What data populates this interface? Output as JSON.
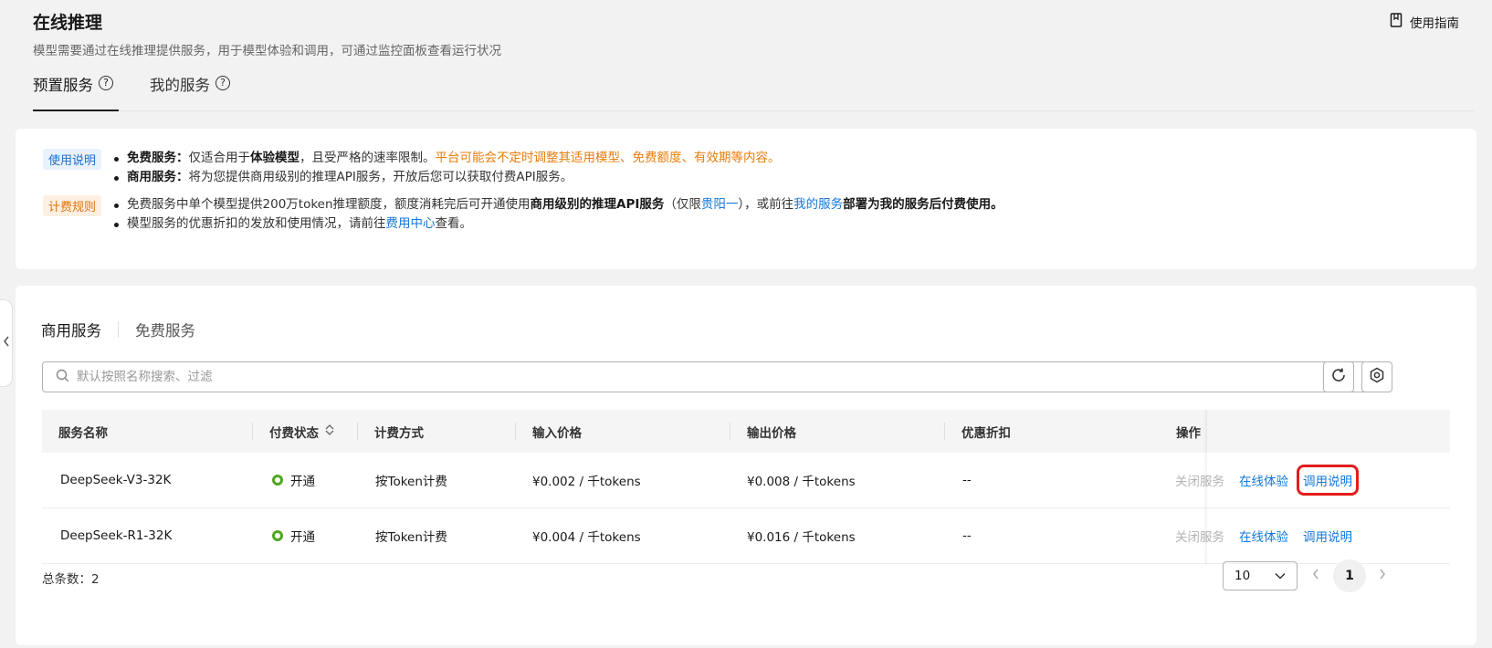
{
  "header": {
    "title": "在线推理",
    "subtitle": "模型需要通过在线推理提供服务，用于模型体验和调用，可通过监控面板查看运行状况",
    "guide_label": "使用指南"
  },
  "tabs": [
    {
      "label": "预置服务"
    },
    {
      "label": "我的服务"
    }
  ],
  "notice": {
    "usage_tag": "使用说明",
    "usage_line1_bold": "免费服务：",
    "usage_line1_text1": "仅适合用于",
    "usage_line1_bold2": "体验模型",
    "usage_line1_text2": "，且受严格的速率限制。",
    "usage_line1_orange": "平台可能会不定时调整其适用模型、免费额度、有效期等内容。",
    "usage_line2_bold": "商用服务：",
    "usage_line2_text": "将为您提供商用级别的推理API服务，开放后您可以获取付费API服务。",
    "billing_tag": "计费规则",
    "billing_line1_text1": "免费服务中单个模型提供200万token推理额度，额度消耗完后可开通使用",
    "billing_line1_bold1": "商用级别的推理API服务",
    "billing_line1_text2": "（仅限",
    "billing_line1_link1": "贵阳一",
    "billing_line1_text3": "），或前往",
    "billing_line1_link2": "我的服务",
    "billing_line1_bold2": "部署为我的服务后付费使用。",
    "billing_line2_text1": "模型服务的优惠折扣的发放和使用情况，请前往",
    "billing_line2_link": "费用中心",
    "billing_line2_text2": "查看。"
  },
  "subtabs": {
    "active": "商用服务",
    "inactive": "免费服务"
  },
  "search": {
    "placeholder": "默认按照名称搜索、过滤"
  },
  "table": {
    "columns": [
      "服务名称",
      "付费状态",
      "计费方式",
      "输入价格",
      "输出价格",
      "优惠折扣",
      "操作"
    ],
    "rows": [
      {
        "name": "DeepSeek-V3-32K",
        "status": "开通",
        "billing": "按Token计费",
        "input_price": "¥0.002 / 千tokens",
        "output_price": "¥0.008 / 千tokens",
        "discount": "--",
        "op_close": "关闭服务",
        "op_try": "在线体验",
        "op_doc": "调用说明"
      },
      {
        "name": "DeepSeek-R1-32K",
        "status": "开通",
        "billing": "按Token计费",
        "input_price": "¥0.004 / 千tokens",
        "output_price": "¥0.016 / 千tokens",
        "discount": "--",
        "op_close": "关闭服务",
        "op_try": "在线体验",
        "op_doc": "调用说明"
      }
    ]
  },
  "pagination": {
    "total_label": "总条数：2",
    "page_size": "10",
    "current_page": "1"
  },
  "colors": {
    "link": "#1477d9",
    "status_on": "#52a61f",
    "highlight": "#e31d1d",
    "warning": "#e77c0b"
  }
}
